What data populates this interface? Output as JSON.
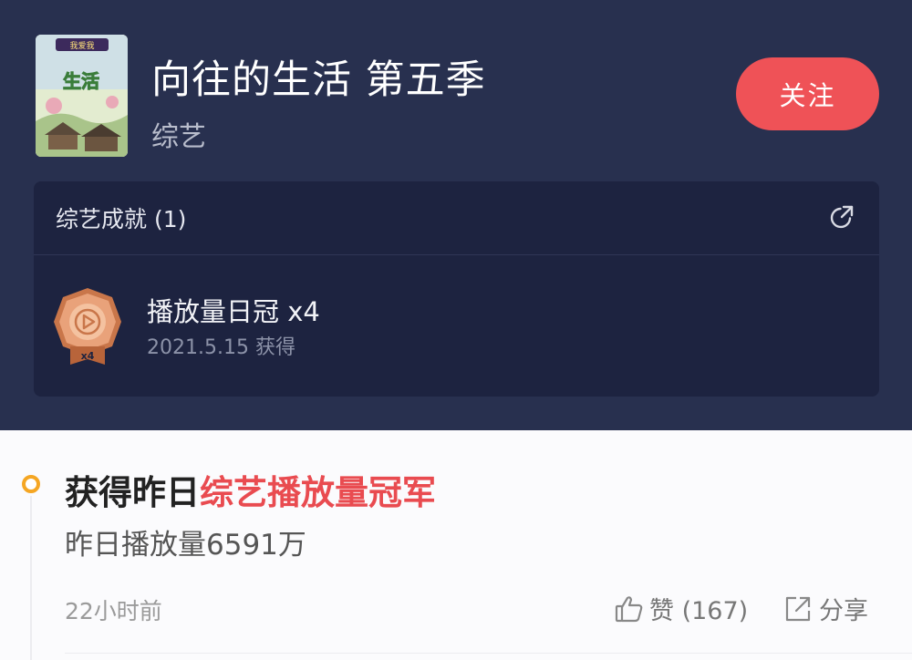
{
  "header": {
    "poster_text": "生活",
    "poster_badge": "我爱我",
    "title": "向往的生活 第五季",
    "category": "综艺",
    "follow_label": "关注"
  },
  "achievements": {
    "heading": "综艺成就 (1)",
    "items": [
      {
        "name": "播放量日冠 x4",
        "date": "2021.5.15 获得",
        "medal_badge": "x4"
      }
    ]
  },
  "post": {
    "title_prefix": "获得昨日",
    "title_highlight": "综艺播放量冠军",
    "subtitle": "昨日播放量6591万",
    "time": "22小时前",
    "like_label": "赞 (167)",
    "share_label": "分享"
  },
  "colors": {
    "header_bg": "#28304f",
    "card_bg": "#1d2340",
    "accent_red": "#ef5257",
    "highlight_red": "#e94b50",
    "timeline_dot": "#f5a623"
  }
}
